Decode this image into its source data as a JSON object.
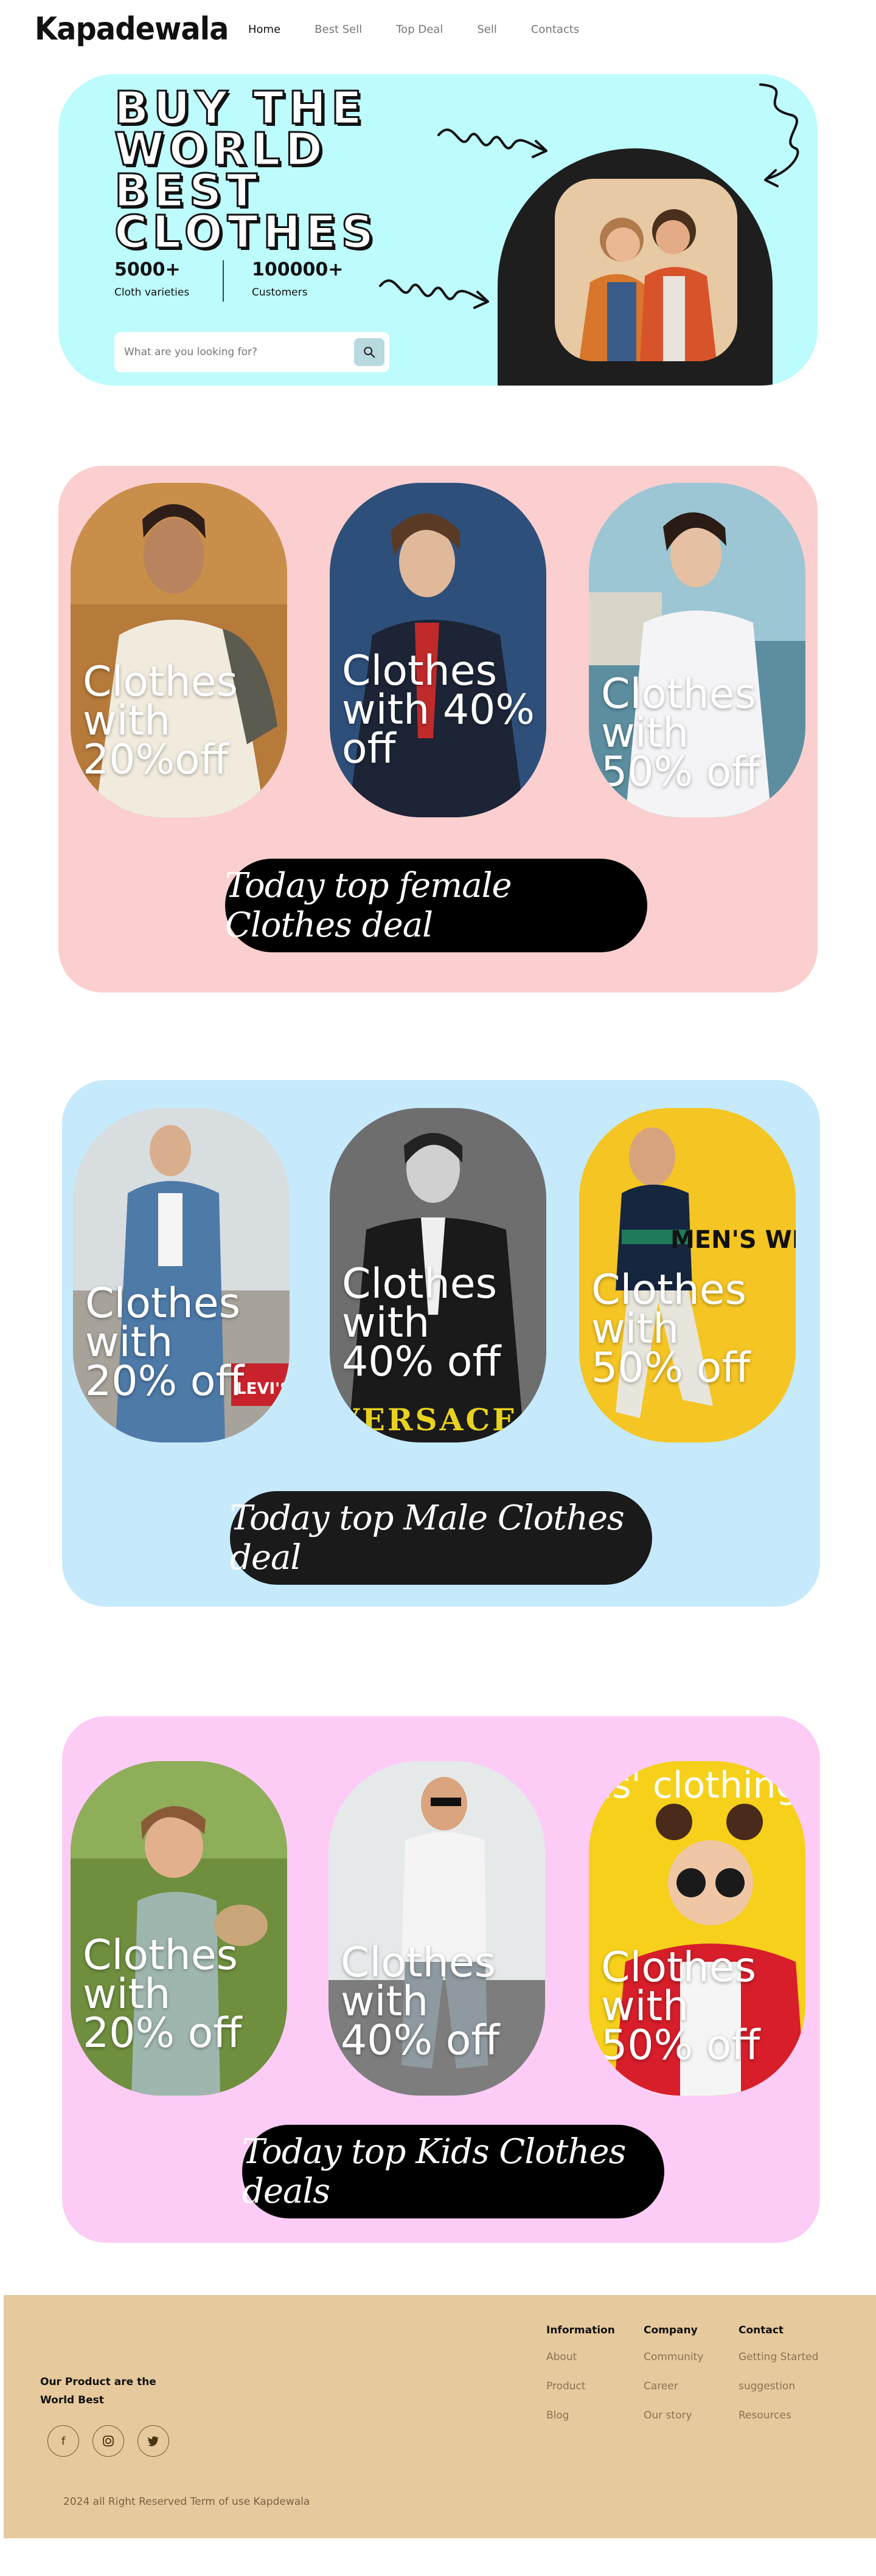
{
  "brand": "Kapadewala",
  "nav": [
    "Home",
    "Best Sell",
    "Top Deal",
    "Sell",
    "Contacts"
  ],
  "hero": {
    "title": "BUY THE\nWORLD\nBEST\nCLOTHES",
    "stats": [
      {
        "value": "5000+",
        "label": "Cloth varieties"
      },
      {
        "value": "100000+",
        "label": "Customers"
      }
    ],
    "search_placeholder": "What are you looking for?",
    "icons": [
      "search-icon",
      "squiggle-arrow-icon"
    ],
    "bg": "#bdfbfd"
  },
  "sections": [
    {
      "bg": "#fbcfcf",
      "cta": "Today top female Clothes deal",
      "cards": [
        {
          "text": "Clothes\nwith\n20%off"
        },
        {
          "text": "Clothes\nwith 40%\noff"
        },
        {
          "text": "Clothes\nwith\n50% off"
        }
      ]
    },
    {
      "bg": "#c6eafc",
      "cta": "Today top Male Clothes deal",
      "cards": [
        {
          "text": "Clothes\nwith\n20% off",
          "brand_text": "LEVI'S"
        },
        {
          "text": "Clothes\nwith\n40% off",
          "brand_text": "VERSACE"
        },
        {
          "text": "Clothes\nwith\n50% off",
          "brand_text": "MEN'S WE"
        }
      ]
    },
    {
      "bg": "#fcccf6",
      "cta": "Today top Kids Clothes deals",
      "cards": [
        {
          "text": "Clothes\nwith\n20% off"
        },
        {
          "text": "Clothes\nwith\n40% off"
        },
        {
          "text": "Clothes\nwith\n50% off",
          "brand_text": "ds' clothing"
        }
      ]
    }
  ],
  "footer": {
    "tagline": "Our Product are the World Best",
    "socials": [
      "facebook-icon",
      "instagram-icon",
      "twitter-icon"
    ],
    "columns": [
      {
        "title": "Information",
        "items": [
          "About",
          "Product",
          "Blog"
        ]
      },
      {
        "title": "Company",
        "items": [
          "Community",
          "Career",
          "Our story"
        ]
      },
      {
        "title": "Contact",
        "items": [
          "Getting Started",
          "suggestion",
          "Resources"
        ]
      }
    ],
    "copyright": "2024  all Right Reserved Term of use  Kapdewala",
    "bg": "#e6c99c"
  }
}
